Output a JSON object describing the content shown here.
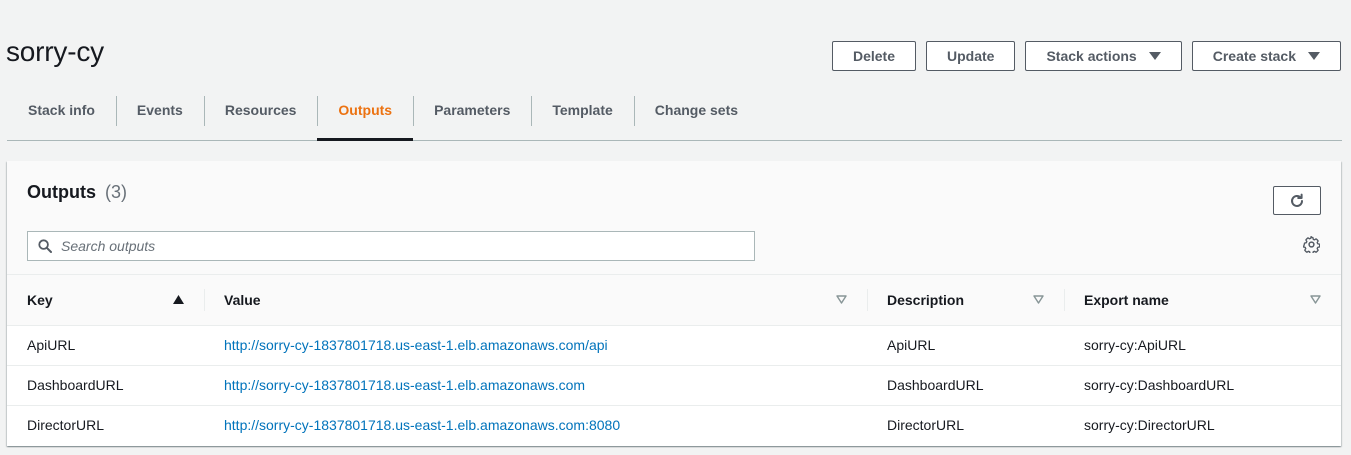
{
  "page_title": "sorry-cy",
  "actions": {
    "delete": "Delete",
    "update": "Update",
    "stack_actions": "Stack actions",
    "create_stack": "Create stack"
  },
  "tabs": [
    {
      "label": "Stack info"
    },
    {
      "label": "Events"
    },
    {
      "label": "Resources"
    },
    {
      "label": "Outputs",
      "active": true
    },
    {
      "label": "Parameters"
    },
    {
      "label": "Template"
    },
    {
      "label": "Change sets"
    }
  ],
  "outputs": {
    "title": "Outputs",
    "count": "(3)",
    "search_placeholder": "Search outputs",
    "columns": [
      "Key",
      "Value",
      "Description",
      "Export name"
    ],
    "rows": [
      {
        "key": "ApiURL",
        "value": "http://sorry-cy-1837801718.us-east-1.elb.amazonaws.com/api",
        "description": "ApiURL",
        "export": "sorry-cy:ApiURL"
      },
      {
        "key": "DashboardURL",
        "value": "http://sorry-cy-1837801718.us-east-1.elb.amazonaws.com",
        "description": "DashboardURL",
        "export": "sorry-cy:DashboardURL"
      },
      {
        "key": "DirectorURL",
        "value": "http://sorry-cy-1837801718.us-east-1.elb.amazonaws.com:8080",
        "description": "DirectorURL",
        "export": "sorry-cy:DirectorURL"
      }
    ]
  },
  "colors": {
    "active_tab": "#ec7211",
    "link": "#0073bb",
    "button_border": "#545b64"
  },
  "icons": {
    "caret": "caret-down-icon",
    "refresh": "refresh-icon",
    "search": "search-icon",
    "settings": "gear-icon",
    "sort_asc": "sort-ascending-icon",
    "sort": "sort-icon"
  }
}
